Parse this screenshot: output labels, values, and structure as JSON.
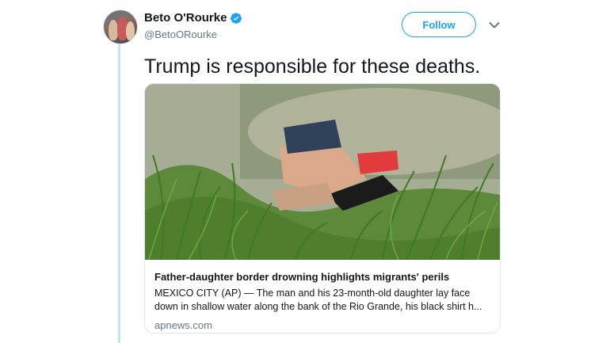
{
  "tweet": {
    "author": {
      "display_name": "Beto O'Rourke",
      "handle": "@BetoORourke",
      "verified": true,
      "verified_icon": "verified-badge-icon"
    },
    "follow_label": "Follow",
    "menu_icon": "chevron-down-icon",
    "text": "Trump is responsible for these deaths."
  },
  "card": {
    "title": "Father-daughter border drowning highlights migrants' perils",
    "description": "MEXICO CITY (AP) — The man and his 23-month-old daughter lay face down in shallow water along the bank of the Rio Grande, his black shirt h...",
    "domain": "apnews.com"
  },
  "colors": {
    "accent": "#1da1f2",
    "text_primary": "#14171a",
    "text_secondary": "#657786",
    "thread_line": "#c4e2f4",
    "border": "#e1e8ed"
  }
}
